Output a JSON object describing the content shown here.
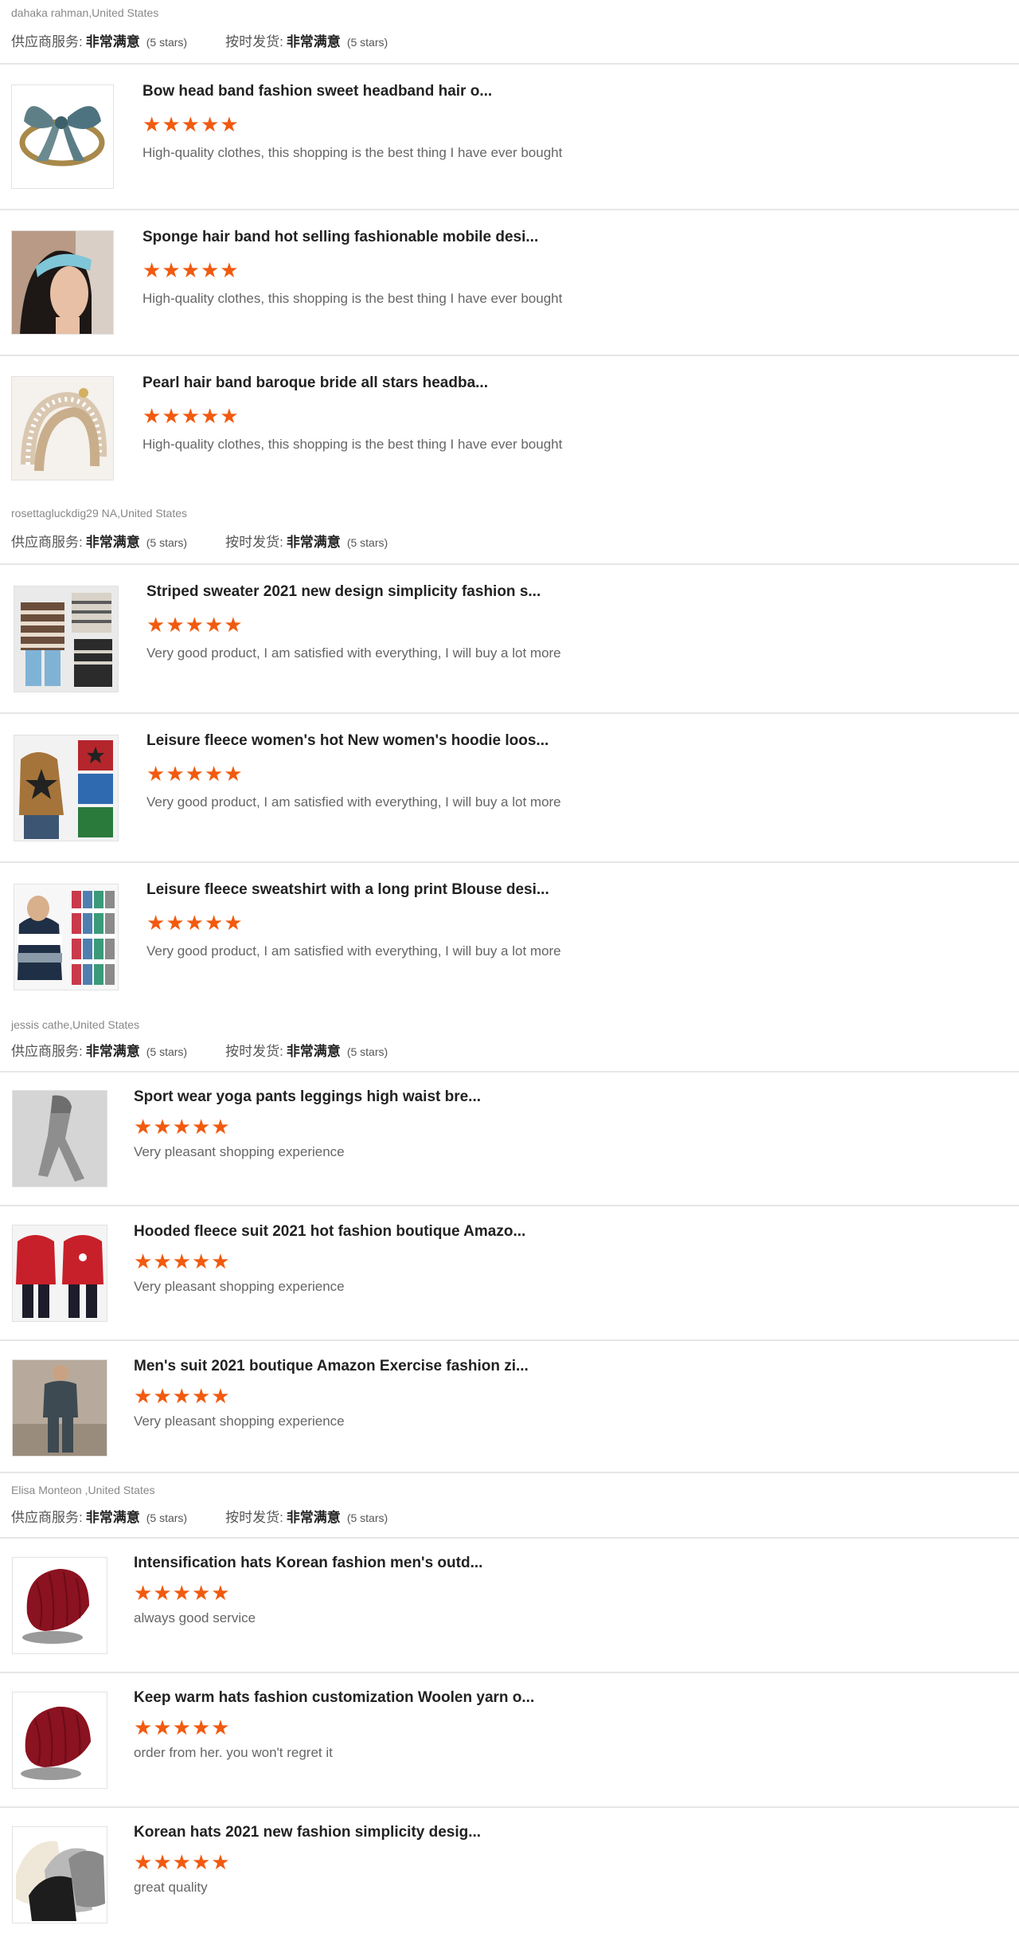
{
  "labels": {
    "supplier_service": "供应商服务:",
    "on_time_delivery": "按时发货:",
    "rating_value": "非常满意",
    "rating_stars": "(5 stars)"
  },
  "colors": {
    "star": "#f15a0f",
    "divider": "#e6e6e6"
  },
  "reviews": [
    {
      "buyer": "dahaka rahman,United States",
      "items": [
        {
          "title": "Bow head band fashion sweet headband hair o...",
          "stars": 5,
          "comment": "High-quality clothes, this shopping is the best thing I have ever bought",
          "thumb": "bow-headband-image"
        },
        {
          "title": "Sponge hair band hot selling fashionable mobile desi...",
          "stars": 5,
          "comment": "High-quality clothes, this shopping is the best thing I have ever bought",
          "thumb": "sponge-hairband-image"
        },
        {
          "title": "Pearl hair band baroque bride all stars headba...",
          "stars": 5,
          "comment": "High-quality clothes, this shopping is the best thing I have ever bought",
          "thumb": "pearl-hairband-image"
        }
      ]
    },
    {
      "buyer": "rosettagluckdig29 NA,United States",
      "items": [
        {
          "title": "Striped sweater 2021 new design simplicity fashion s...",
          "stars": 5,
          "comment": "Very good product, I am satisfied with everything, I will buy a lot more",
          "thumb": "striped-sweater-image"
        },
        {
          "title": "Leisure fleece women's hot New women's hoodie loos...",
          "stars": 5,
          "comment": "Very good product, I am satisfied with everything, I will buy a lot more",
          "thumb": "star-hoodie-image"
        },
        {
          "title": "Leisure fleece sweatshirt with a long print Blouse desi...",
          "stars": 5,
          "comment": "Very good product, I am satisfied with everything, I will buy a lot more",
          "thumb": "print-sweatshirt-image"
        }
      ]
    },
    {
      "buyer": "jessis cathe,United States",
      "items": [
        {
          "title": "Sport wear yoga pants leggings high waist bre...",
          "stars": 5,
          "comment": "Very pleasant shopping experience",
          "thumb": "yoga-leggings-image"
        },
        {
          "title": "Hooded fleece suit 2021 hot fashion boutique Amazo...",
          "stars": 5,
          "comment": "Very pleasant shopping experience",
          "thumb": "hooded-suit-image"
        },
        {
          "title": "Men's suit 2021 boutique Amazon Exercise fashion zi...",
          "stars": 5,
          "comment": "Very pleasant shopping experience",
          "thumb": "mens-suit-image"
        }
      ]
    },
    {
      "buyer": "Elisa Monteon ,United States",
      "items": [
        {
          "title": "Intensification hats Korean fashion men's outd...",
          "stars": 5,
          "comment": "always good service",
          "thumb": "red-beanie-image"
        },
        {
          "title": "Keep warm hats fashion customization Woolen yarn o...",
          "stars": 5,
          "comment": "order from her. you won't regret it",
          "thumb": "woolen-hat-image"
        },
        {
          "title": "Korean hats 2021 new fashion simplicity desig...",
          "stars": 5,
          "comment": "great quality",
          "thumb": "korean-hats-image"
        }
      ]
    }
  ]
}
